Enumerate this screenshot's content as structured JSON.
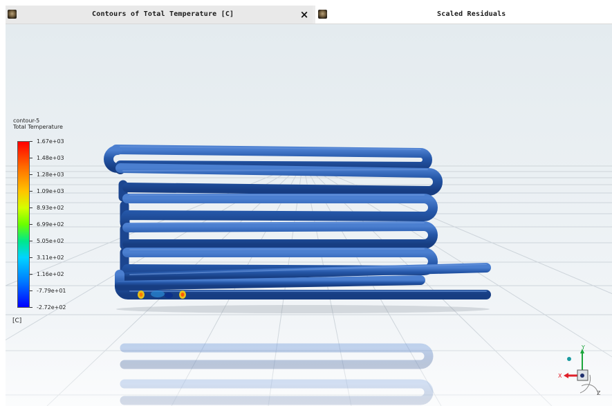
{
  "tabs": [
    {
      "title": "Contours of Total Temperature [C]",
      "close_symbol": "×",
      "icon": "fluent-app-icon",
      "active": true
    },
    {
      "title": "Scaled Residuals",
      "icon": "fluent-app-icon",
      "active": false
    }
  ],
  "legend": {
    "name": "contour-5",
    "variable": "Total Temperature",
    "unit": "[C]",
    "levels": [
      "1.67e+03",
      "1.48e+03",
      "1.28e+03",
      "1.09e+03",
      "8.93e+02",
      "6.99e+02",
      "5.05e+02",
      "3.11e+02",
      "1.16e+02",
      "-7.79e+01",
      "-2.72e+02"
    ],
    "colormap": [
      "#ff0000",
      "#ff6a00",
      "#ffc400",
      "#d4ff00",
      "#6aff00",
      "#00e88a",
      "#00d4ff",
      "#0077ff",
      "#0000ff"
    ]
  },
  "axis_triad": {
    "x_label": "X",
    "y_label": "Y",
    "z_label": "Z"
  },
  "colors": {
    "pipe": "#1f4e9c",
    "pipe_highlight": "#3f73c6",
    "hot_spot": "#e8c020",
    "floor_grid": "#c9d0d6",
    "tab_active": "#e9e9e9",
    "x_axis": "#e0202a",
    "y_axis": "#1aa53a",
    "z_axis": "#1f4e9c"
  }
}
